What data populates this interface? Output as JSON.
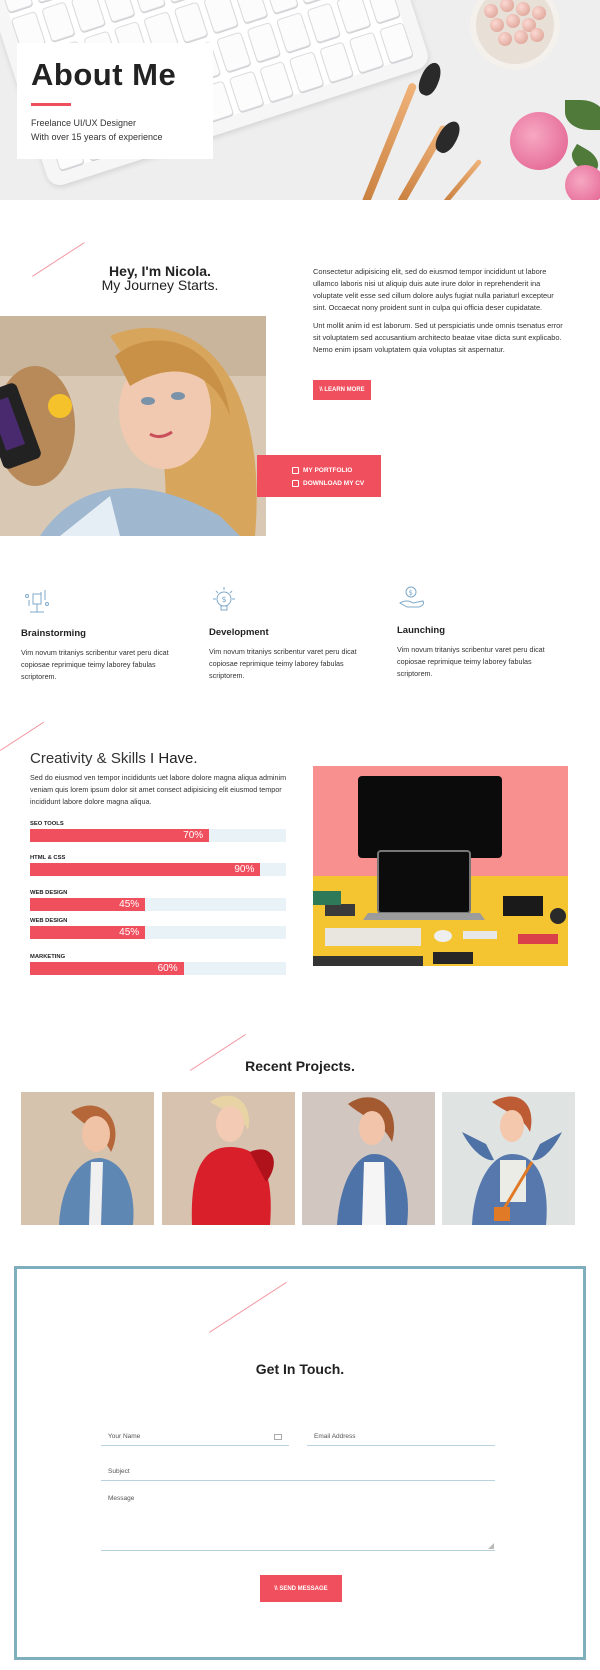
{
  "hero": {
    "title": "About Me",
    "subtitle_line1": "Freelance UI/UX Designer",
    "subtitle_line2": "With over 15 years of experience"
  },
  "intro": {
    "heading_line1": "Hey, I'm Nicola.",
    "heading_line2": "My Journey Starts.",
    "paragraph1": "Consectetur adipisicing elit, sed do eiusmod tempor incididunt ut labore ullamco laboris nisi ut aliquip duis aute irure dolor in reprehenderit ina voluptate velit esse sed cillum dolore aulys fugiat nulla pariaturl excepteur sint. Occaecat nony proident sunt in culpa qui officia deser cupidatate.",
    "paragraph2": "Unt mollit anim id est laborum. Sed ut perspiciatis unde omnis tsenatus error sit voluptatem sed accusantium architecto beatae vitae dicta sunt explicabo. Nemo enim ipsam voluptatem quia voluptas sit aspernatur.",
    "learn_more": "\\\\ LEARN MORE",
    "portfolio": "MY PORTFOLIO",
    "download_cv": "DOWNLOAD MY CV"
  },
  "features": [
    {
      "icon": "brainstorm-icon",
      "title": "Brainstorming",
      "text": "Vim novum tritaniys scribentur varet peru dicat copiosae reprimique teimy laborey fabulas scriptorem."
    },
    {
      "icon": "development-icon",
      "title": "Development",
      "text": "Vim novum tritaniys scribentur varet peru dicat copiosae reprimique teimy laborey fabulas scriptorem."
    },
    {
      "icon": "launching-icon",
      "title": "Launching",
      "text": "Vim novum tritaniys scribentur varet peru dicat copiosae reprimique teimy laborey fabulas scriptorem."
    }
  ],
  "skills": {
    "title_light": "Creativity & Skills",
    "title_bold": "I Have.",
    "description": "Sed do eiusmod ven tempor incididunts uet labore dolore magna aliqua adminim veniam quis lorem ipsum dolor sit amet consect adipisicing elit eiusmod tempor incididunt labore dolore magna aliqua.",
    "items": [
      {
        "label": "SEO TOOLS",
        "percent": 70,
        "percent_text": "70%"
      },
      {
        "label": "HTML & CSS",
        "percent": 90,
        "percent_text": "90%"
      },
      {
        "label": "WEB DESIGN",
        "percent": 45,
        "percent_text": "45%"
      },
      {
        "label": "WEB DESIGN",
        "percent": 45,
        "percent_text": "45%"
      },
      {
        "label": "MARKETING",
        "percent": 60,
        "percent_text": "60%"
      }
    ]
  },
  "projects": {
    "title": "Recent Projects.",
    "items": [
      "project-1",
      "project-2",
      "project-3",
      "project-4"
    ]
  },
  "contact": {
    "title": "Get In Touch.",
    "name_placeholder": "Your Name",
    "email_placeholder": "Email Address",
    "subject_placeholder": "Subject",
    "message_placeholder": "Message",
    "send": "\\\\ SEND MESSAGE"
  },
  "colors": {
    "accent": "#f0505e",
    "border": "#7faebe",
    "track": "#e9f2f6"
  }
}
